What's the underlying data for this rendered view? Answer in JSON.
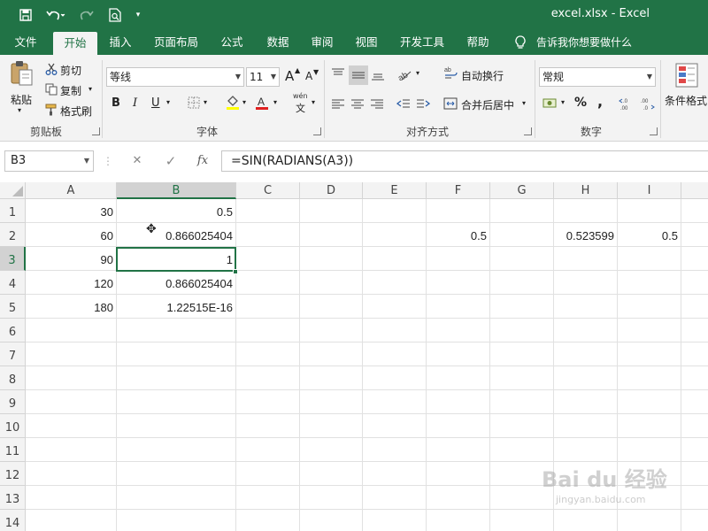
{
  "window": {
    "title": "excel.xlsx  -  Excel",
    "accent_color": "#217346"
  },
  "quick_access": {
    "save_icon": "save-icon",
    "undo_icon": "undo-icon",
    "redo_icon": "redo-icon",
    "print_preview_icon": "print-preview-icon",
    "customize_icon": "customize-qat-icon"
  },
  "tabs": [
    {
      "label": "文件"
    },
    {
      "label": "开始",
      "active": true
    },
    {
      "label": "插入"
    },
    {
      "label": "页面布局"
    },
    {
      "label": "公式"
    },
    {
      "label": "数据"
    },
    {
      "label": "审阅"
    },
    {
      "label": "视图"
    },
    {
      "label": "开发工具"
    },
    {
      "label": "帮助"
    }
  ],
  "tell_me": "告诉我你想要做什么",
  "ribbon": {
    "clipboard": {
      "label": "剪贴板",
      "paste": "粘贴",
      "cut": "剪切",
      "copy": "复制",
      "format_painter": "格式刷"
    },
    "font": {
      "label": "字体",
      "font_name": "等线",
      "font_size": "11",
      "bold": "B",
      "italic": "I",
      "underline": "U",
      "increase_size": "A",
      "decrease_size": "A",
      "phonetic": "wén"
    },
    "alignment": {
      "label": "对齐方式",
      "wrap_text": "自动换行",
      "merge_center": "合并后居中"
    },
    "number": {
      "label": "数字",
      "format": "常规",
      "percent": "%",
      "comma": ","
    },
    "styles": {
      "conditional": "条件格式"
    }
  },
  "formula_bar": {
    "name_box": "B3",
    "cancel": "✕",
    "enter": "✓",
    "fx": "fx",
    "formula": "=SIN(RADIANS(A3))"
  },
  "grid": {
    "columns": [
      "A",
      "B",
      "C",
      "D",
      "E",
      "F",
      "G",
      "H",
      "I"
    ],
    "rows": [
      "1",
      "2",
      "3",
      "4",
      "5",
      "6",
      "7",
      "8",
      "9",
      "10",
      "11",
      "12",
      "13",
      "14"
    ],
    "selected_column": "B",
    "selected_row": "3",
    "cells": {
      "A1": "30",
      "B1": "0.5",
      "A2": "60",
      "B2": "0.866025404",
      "F2": "0.5",
      "H2": "0.523599",
      "I2": "0.5",
      "A3": "90",
      "B3": "1",
      "A4": "120",
      "B4": "0.866025404",
      "A5": "180",
      "B5": "1.22515E-16"
    }
  },
  "watermark": {
    "brand": "Bai du 经验",
    "url": "jingyan.baidu.com"
  }
}
